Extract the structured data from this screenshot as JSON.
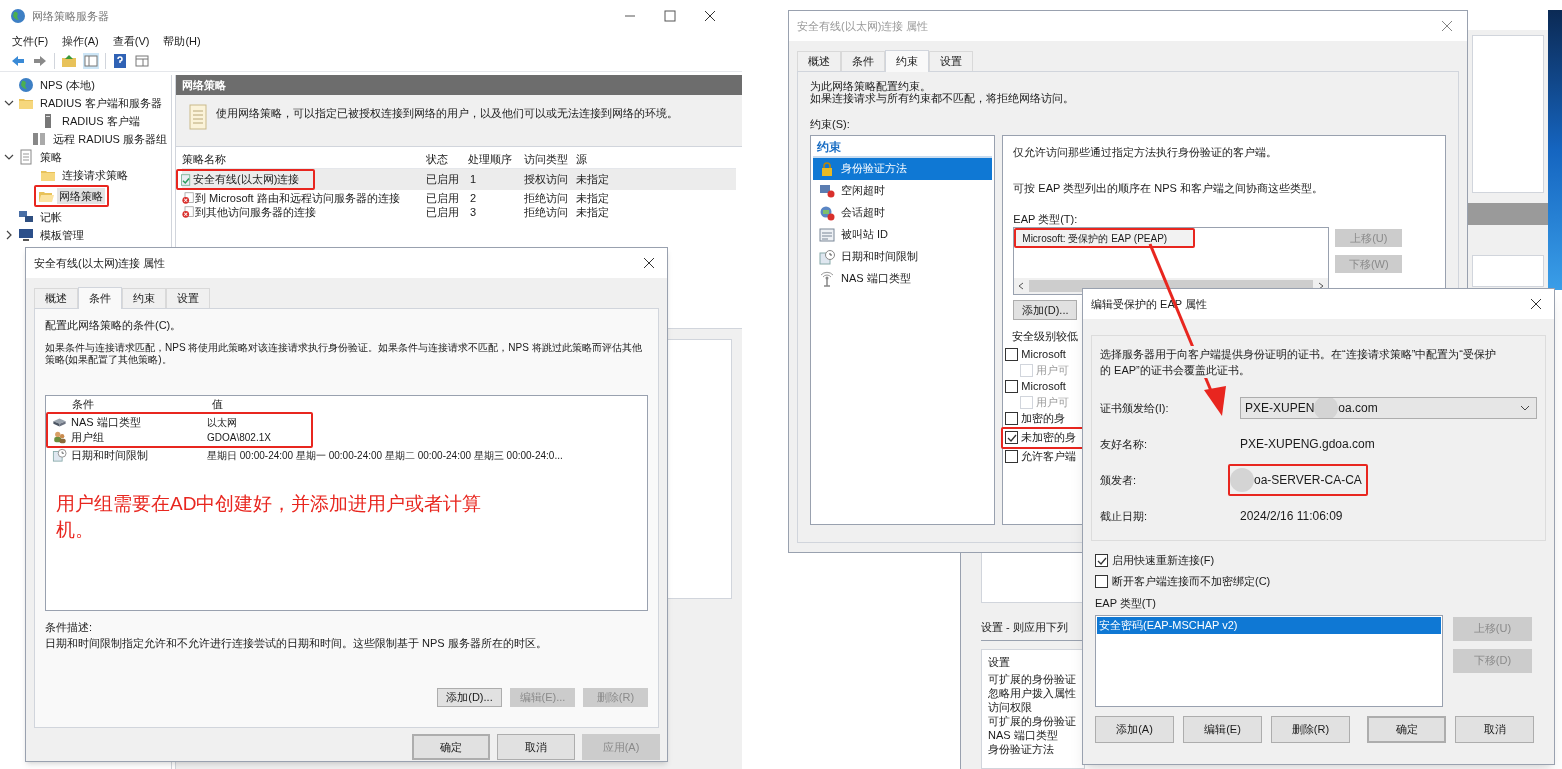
{
  "nps_window": {
    "title": "网络策略服务器",
    "menu": [
      "文件(F)",
      "操作(A)",
      "查看(V)",
      "帮助(H)"
    ],
    "tree": [
      {
        "label": "NPS (本地)",
        "kind": "globe",
        "selected": false,
        "highlighted": false
      },
      {
        "label": "RADIUS 客户端和服务器",
        "kind": "folder",
        "expanded": true,
        "selected": false,
        "highlighted": false,
        "children": [
          {
            "label": "RADIUS 客户端",
            "kind": "client",
            "selected": false,
            "highlighted": false
          },
          {
            "label": "远程 RADIUS 服务器组",
            "kind": "servers",
            "selected": false,
            "highlighted": false
          }
        ]
      },
      {
        "label": "策略",
        "kind": "policy",
        "expanded": true,
        "selected": false,
        "highlighted": false,
        "children": [
          {
            "label": "连接请求策略",
            "kind": "folder",
            "selected": false,
            "highlighted": false
          },
          {
            "label": "网络策略",
            "kind": "open-folder",
            "selected": true,
            "highlighted": true
          }
        ]
      },
      {
        "label": "记帐",
        "kind": "accounting",
        "selected": false,
        "highlighted": false
      },
      {
        "label": "模板管理",
        "kind": "templates",
        "expanded": false,
        "selected": false,
        "highlighted": false
      }
    ],
    "header": "网络策略",
    "description": "使用网络策略，可以指定已被授权连接到网络的用户，以及他们可以或无法连接到网络的环境。",
    "columns": [
      "策略名称",
      "状态",
      "处理顺序",
      "访问类型",
      "源"
    ],
    "rows": [
      {
        "name": "安全有线(以太网)连接",
        "status": "已启用",
        "order": "1",
        "access": "授权访问",
        "source": "未指定",
        "kind": "allow",
        "selected": true,
        "highlighted": true
      },
      {
        "name": "到 Microsoft 路由和远程访问服务器的连接",
        "status": "已启用",
        "order": "2",
        "access": "拒绝访问",
        "source": "未指定",
        "kind": "deny",
        "selected": false,
        "highlighted": false
      },
      {
        "name": "到其他访问服务器的连接",
        "status": "已启用",
        "order": "3",
        "access": "拒绝访问",
        "source": "未指定",
        "kind": "deny",
        "selected": false,
        "highlighted": false
      }
    ]
  },
  "conditions_dialog": {
    "title": "安全有线(以太网)连接 属性",
    "tabs": [
      {
        "label": "概述",
        "selected": false
      },
      {
        "label": "条件",
        "selected": true
      },
      {
        "label": "约束",
        "selected": false
      },
      {
        "label": "设置",
        "selected": false
      }
    ],
    "intro": "配置此网络策略的条件(C)。",
    "explanation": "如果条件与连接请求匹配，NPS 将使用此策略对该连接请求执行身份验证。如果条件与连接请求不匹配，NPS 将跳过此策略而评估其他策略(如果配置了其他策略)。",
    "columns": [
      "条件",
      "值"
    ],
    "rows": [
      {
        "condition": "NAS 端口类型",
        "value": "以太网",
        "kind": "port",
        "highlighted": true
      },
      {
        "condition": "用户组",
        "value": "GDOA\\802.1X",
        "kind": "group",
        "highlighted": true
      },
      {
        "condition": "日期和时间限制",
        "value": "星期日 00:00-24:00 星期一 00:00-24:00 星期二 00:00-24:00 星期三 00:00-24:0...",
        "kind": "time",
        "highlighted": false
      }
    ],
    "note": "用户组需要在AD中创建好，并添加进用户或者计算机。",
    "description_label": "条件描述:",
    "description": "日期和时间限制指定允许和不允许进行连接尝试的日期和时间。这些限制基于 NPS 服务器所在的时区。",
    "list_buttons": [
      {
        "label": "添加(D)...",
        "disabled": false
      },
      {
        "label": "编辑(E)...",
        "disabled": true
      },
      {
        "label": "删除(R)",
        "disabled": true
      }
    ],
    "buttons": [
      {
        "label": "确定",
        "default": true,
        "disabled": false
      },
      {
        "label": "取消",
        "default": false,
        "disabled": false
      },
      {
        "label": "应用(A)",
        "default": false,
        "disabled": true
      }
    ]
  },
  "constraints_dialog": {
    "title": "安全有线(以太网)连接 属性",
    "tabs": [
      {
        "label": "概述",
        "selected": false
      },
      {
        "label": "条件",
        "selected": false
      },
      {
        "label": "约束",
        "selected": true
      },
      {
        "label": "设置",
        "selected": false
      }
    ],
    "intro": [
      "为此网络策略配置约束。",
      "如果连接请求与所有约束都不匹配，将拒绝网络访问。"
    ],
    "list_label": "约束(S):",
    "list_header": "约束",
    "items": [
      {
        "label": "身份验证方法",
        "kind": "lock",
        "selected": true
      },
      {
        "label": "空闲超时",
        "kind": "idle",
        "selected": false
      },
      {
        "label": "会话超时",
        "kind": "session",
        "selected": false
      },
      {
        "label": "被叫站 ID",
        "kind": "station",
        "selected": false
      },
      {
        "label": "日期和时间限制",
        "kind": "time",
        "selected": false
      },
      {
        "label": "NAS 端口类型",
        "kind": "antenna",
        "selected": false
      }
    ],
    "text1": "仅允许访问那些通过指定方法执行身份验证的客户端。",
    "text2": "可按 EAP 类型列出的顺序在 NPS 和客户端之间协商这些类型。",
    "eap_label": "EAP 类型(T):",
    "eap_types": [
      {
        "label": "Microsoft: 受保护的 EAP (PEAP)",
        "highlighted": true
      }
    ],
    "move_buttons": [
      {
        "label": "上移(U)",
        "disabled": true
      },
      {
        "label": "下移(W)",
        "disabled": true
      }
    ],
    "add_button": "添加(D)...",
    "security_label": "安全级别较低",
    "methods": [
      {
        "label": "Microsoft",
        "checked": false,
        "disabled": false,
        "highlighted": false,
        "children": [
          {
            "label": "用户可",
            "checked": false,
            "disabled": true,
            "highlighted": false
          }
        ]
      },
      {
        "label": "Microsoft",
        "checked": false,
        "disabled": false,
        "highlighted": false,
        "children": [
          {
            "label": "用户可",
            "checked": false,
            "disabled": true,
            "highlighted": false
          }
        ]
      },
      {
        "label": "加密的身",
        "checked": false,
        "disabled": false,
        "highlighted": false
      },
      {
        "label": "未加密的身",
        "checked": true,
        "disabled": false,
        "highlighted": true
      },
      {
        "label": "允许客户端",
        "checked": false,
        "disabled": false,
        "highlighted": false
      }
    ]
  },
  "policy_window_behind": {
    "section_label": "设置 - 则应用下列",
    "settings_header": "设置",
    "settings": [
      "可扩展的身份验证",
      "忽略用户拨入属性",
      "访问权限",
      "可扩展的身份验证",
      "NAS 端口类型",
      "身份验证方法"
    ]
  },
  "eap_dialog": {
    "title": "编辑受保护的 EAP 属性",
    "description": "选择服务器用于向客户端提供身份证明的证书。在“连接请求策略”中配置为“受保护的 EAP”的证书会覆盖此证书。",
    "fields": [
      {
        "kind": "dropdown",
        "label": "证书颁发给(I):",
        "value": "PXE-XUPEN",
        "value_end": "oa.com",
        "highlighted": false
      },
      {
        "kind": "text",
        "label": "友好名称:",
        "value": "PXE-XUPENG.gdoa.com",
        "highlighted": false
      },
      {
        "kind": "redacted",
        "label": "颁发者:",
        "value": "oa-SERVER-CA-CA",
        "highlighted": true
      },
      {
        "kind": "text",
        "label": "截止日期:",
        "value": "2024/2/16 11:06:09",
        "highlighted": false
      }
    ],
    "options": [
      {
        "label": "启用快速重新连接(F)",
        "checked": true
      },
      {
        "label": "断开客户端连接而不加密绑定(C)",
        "checked": false
      }
    ],
    "eap_label": "EAP 类型(T)",
    "eap_types": [
      {
        "label": "安全密码(EAP-MSCHAP v2)",
        "selected": true
      }
    ],
    "move_buttons": [
      {
        "label": "上移(U)",
        "disabled": true
      },
      {
        "label": "下移(D)",
        "disabled": true
      }
    ],
    "buttons": [
      {
        "label": "添加(A)",
        "default": false
      },
      {
        "label": "编辑(E)",
        "default": false
      },
      {
        "label": "删除(R)",
        "default": false
      },
      {
        "label": "确定",
        "default": true
      },
      {
        "label": "取消",
        "default": false
      }
    ]
  }
}
